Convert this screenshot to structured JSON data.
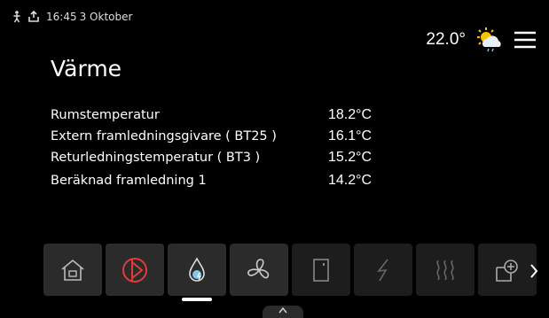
{
  "status_bar": {
    "time": "16:45",
    "date": "3 Oktober"
  },
  "header": {
    "outdoor_temp": "22.0°"
  },
  "page": {
    "title": "Värme"
  },
  "readings": [
    {
      "label": "Rumstemperatur",
      "value": "18.2°C"
    },
    {
      "label": "Extern framledningsgivare (  BT25 )",
      "value": "16.1°C"
    },
    {
      "label": "Returledningstemperatur ( BT3 )",
      "value": "15.2°C"
    },
    {
      "label": "Beräknad framledning 1",
      "value": "14.2°C"
    }
  ],
  "tabs": [
    {
      "name": "home-icon",
      "active": false
    },
    {
      "name": "heat-pump-icon",
      "active": false
    },
    {
      "name": "water-drop-icon",
      "active": true
    },
    {
      "name": "fan-icon",
      "active": false
    },
    {
      "name": "door-icon",
      "active": false
    },
    {
      "name": "electric-icon",
      "active": false
    },
    {
      "name": "heat-waves-icon",
      "active": false
    },
    {
      "name": "add-zone-icon",
      "active": false
    }
  ],
  "colors": {
    "accent_red": "#e23b3b",
    "water_blue": "#7fc6ea",
    "sun_yellow": "#f5c400"
  }
}
